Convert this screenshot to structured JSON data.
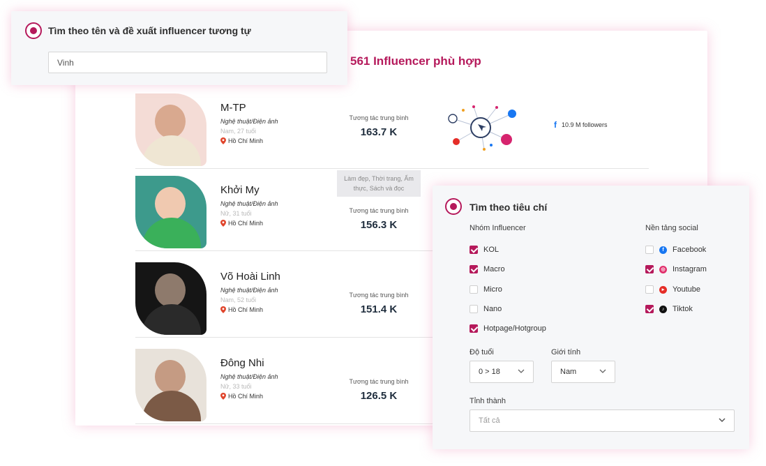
{
  "results": {
    "count_title": "561 Influencer phù hợp",
    "engagement_label": "Tương tác trung bình",
    "influencers": [
      {
        "name": "M-TP",
        "category": "Nghệ thuật/Điện ảnh",
        "meta": "Nam, 27 tuổi",
        "location": "Hồ Chí Minh",
        "avg_engagement": "163.7 K",
        "followers": "10.9 M followers"
      },
      {
        "name": "Khởi My",
        "category": "Nghệ thuật/Điện ảnh",
        "meta": "Nữ, 31 tuổi",
        "location": "Hồ Chí Minh",
        "avg_engagement": "156.3 K",
        "tags": "Làm đẹp, Thời trang, Ẩm thực, Sách và đọc"
      },
      {
        "name": "Võ Hoài Linh",
        "category": "Nghệ thuật/Điện ảnh",
        "meta": "Nam, 52 tuổi",
        "location": "Hồ Chí Minh",
        "avg_engagement": "151.4 K"
      },
      {
        "name": "Đông Nhi",
        "category": "Nghệ thuật/Điện ảnh",
        "meta": "Nữ, 33 tuổi",
        "location": "Hồ Chí Minh",
        "avg_engagement": "126.5 K"
      }
    ]
  },
  "name_search": {
    "title": "Tìm theo tên và đề xuất influencer tương tự",
    "input_value": "Vinh"
  },
  "criteria": {
    "title": "Tìm theo tiêu chí",
    "group_label": "Nhóm Influencer",
    "groups": [
      {
        "label": "KOL",
        "checked": true
      },
      {
        "label": "Macro",
        "checked": true
      },
      {
        "label": "Micro",
        "checked": false
      },
      {
        "label": "Nano",
        "checked": false
      },
      {
        "label": "Hotpage/Hotgroup",
        "checked": true
      }
    ],
    "platform_label": "Nền tảng social",
    "platforms": [
      {
        "label": "Facebook",
        "checked": false,
        "icon": "facebook-icon",
        "color": "#1877f2"
      },
      {
        "label": "Instagram",
        "checked": true,
        "icon": "instagram-icon",
        "color": "#e1306c"
      },
      {
        "label": "Youtube",
        "checked": false,
        "icon": "youtube-icon",
        "color": "#e52d27"
      },
      {
        "label": "Tiktok",
        "checked": true,
        "icon": "tiktok-icon",
        "color": "#111111"
      }
    ],
    "age_label": "Độ tuổi",
    "age_value": "0 > 18",
    "gender_label": "Giới tính",
    "gender_value": "Nam",
    "province_label": "Tỉnh thành",
    "province_value": "Tất cả"
  },
  "colors": {
    "accent": "#b5195b"
  }
}
